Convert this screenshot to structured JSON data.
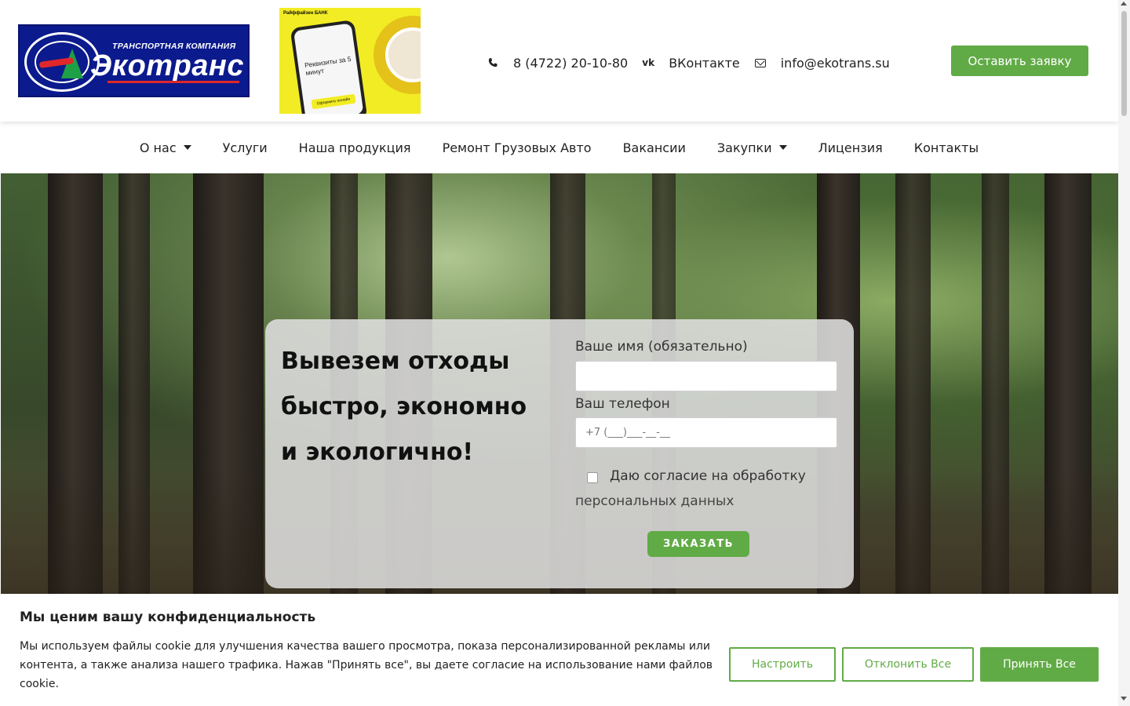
{
  "header": {
    "logo": {
      "subtitle": "ТРАНСПОРТНАЯ КОМПАНИЯ",
      "name": "Экотранс"
    },
    "banner": {
      "bank": "Райффайзен БАНК",
      "text": "Реквизиты за 5 минут",
      "button": "Оформить онлайн"
    },
    "contacts": {
      "phone": "8 (4722) 20-10-80",
      "vk": "ВКонтакте",
      "vk_icon": "vk",
      "email": "info@ekotrans.su"
    },
    "cta_label": "Оставить заявку"
  },
  "nav": {
    "items": [
      {
        "label": "О нас",
        "dropdown": true
      },
      {
        "label": "Услуги",
        "dropdown": false
      },
      {
        "label": "Наша продукция",
        "dropdown": false
      },
      {
        "label": "Ремонт Грузовых Авто",
        "dropdown": false
      },
      {
        "label": "Вакансии",
        "dropdown": false
      },
      {
        "label": "Закупки",
        "dropdown": true
      },
      {
        "label": "Лицензия",
        "dropdown": false
      },
      {
        "label": "Контакты",
        "dropdown": false
      }
    ]
  },
  "hero": {
    "headline_lines": [
      "Вывезем отходы",
      "быстро, экономно",
      "и экологично!"
    ],
    "form": {
      "name_label": "Ваше имя (обязательно)",
      "name_value": "",
      "phone_label": "Ваш телефон",
      "phone_placeholder": "+7 (___)___-__-__",
      "consent_line1": "Даю согласие на обработку",
      "consent_line2": "персональных данных",
      "consent_checked": false,
      "submit_label": "ЗАКАЗАТЬ"
    }
  },
  "cookie": {
    "title": "Мы ценим вашу конфиденциальность",
    "text": "Мы используем файлы cookie для улучшения качества вашего просмотра, показа персонализированной рекламы или контента, а также анализа нашего трафика. Нажав \"Принять все\", вы даете согласие на использование нами файлов cookie.",
    "customize_label": "Настроить",
    "reject_label": "Отклонить Все",
    "accept_label": "Принять Все"
  },
  "colors": {
    "accent": "#61ab46",
    "logo_bg": "#0b1a8c",
    "banner_bg": "#f2ec24"
  }
}
